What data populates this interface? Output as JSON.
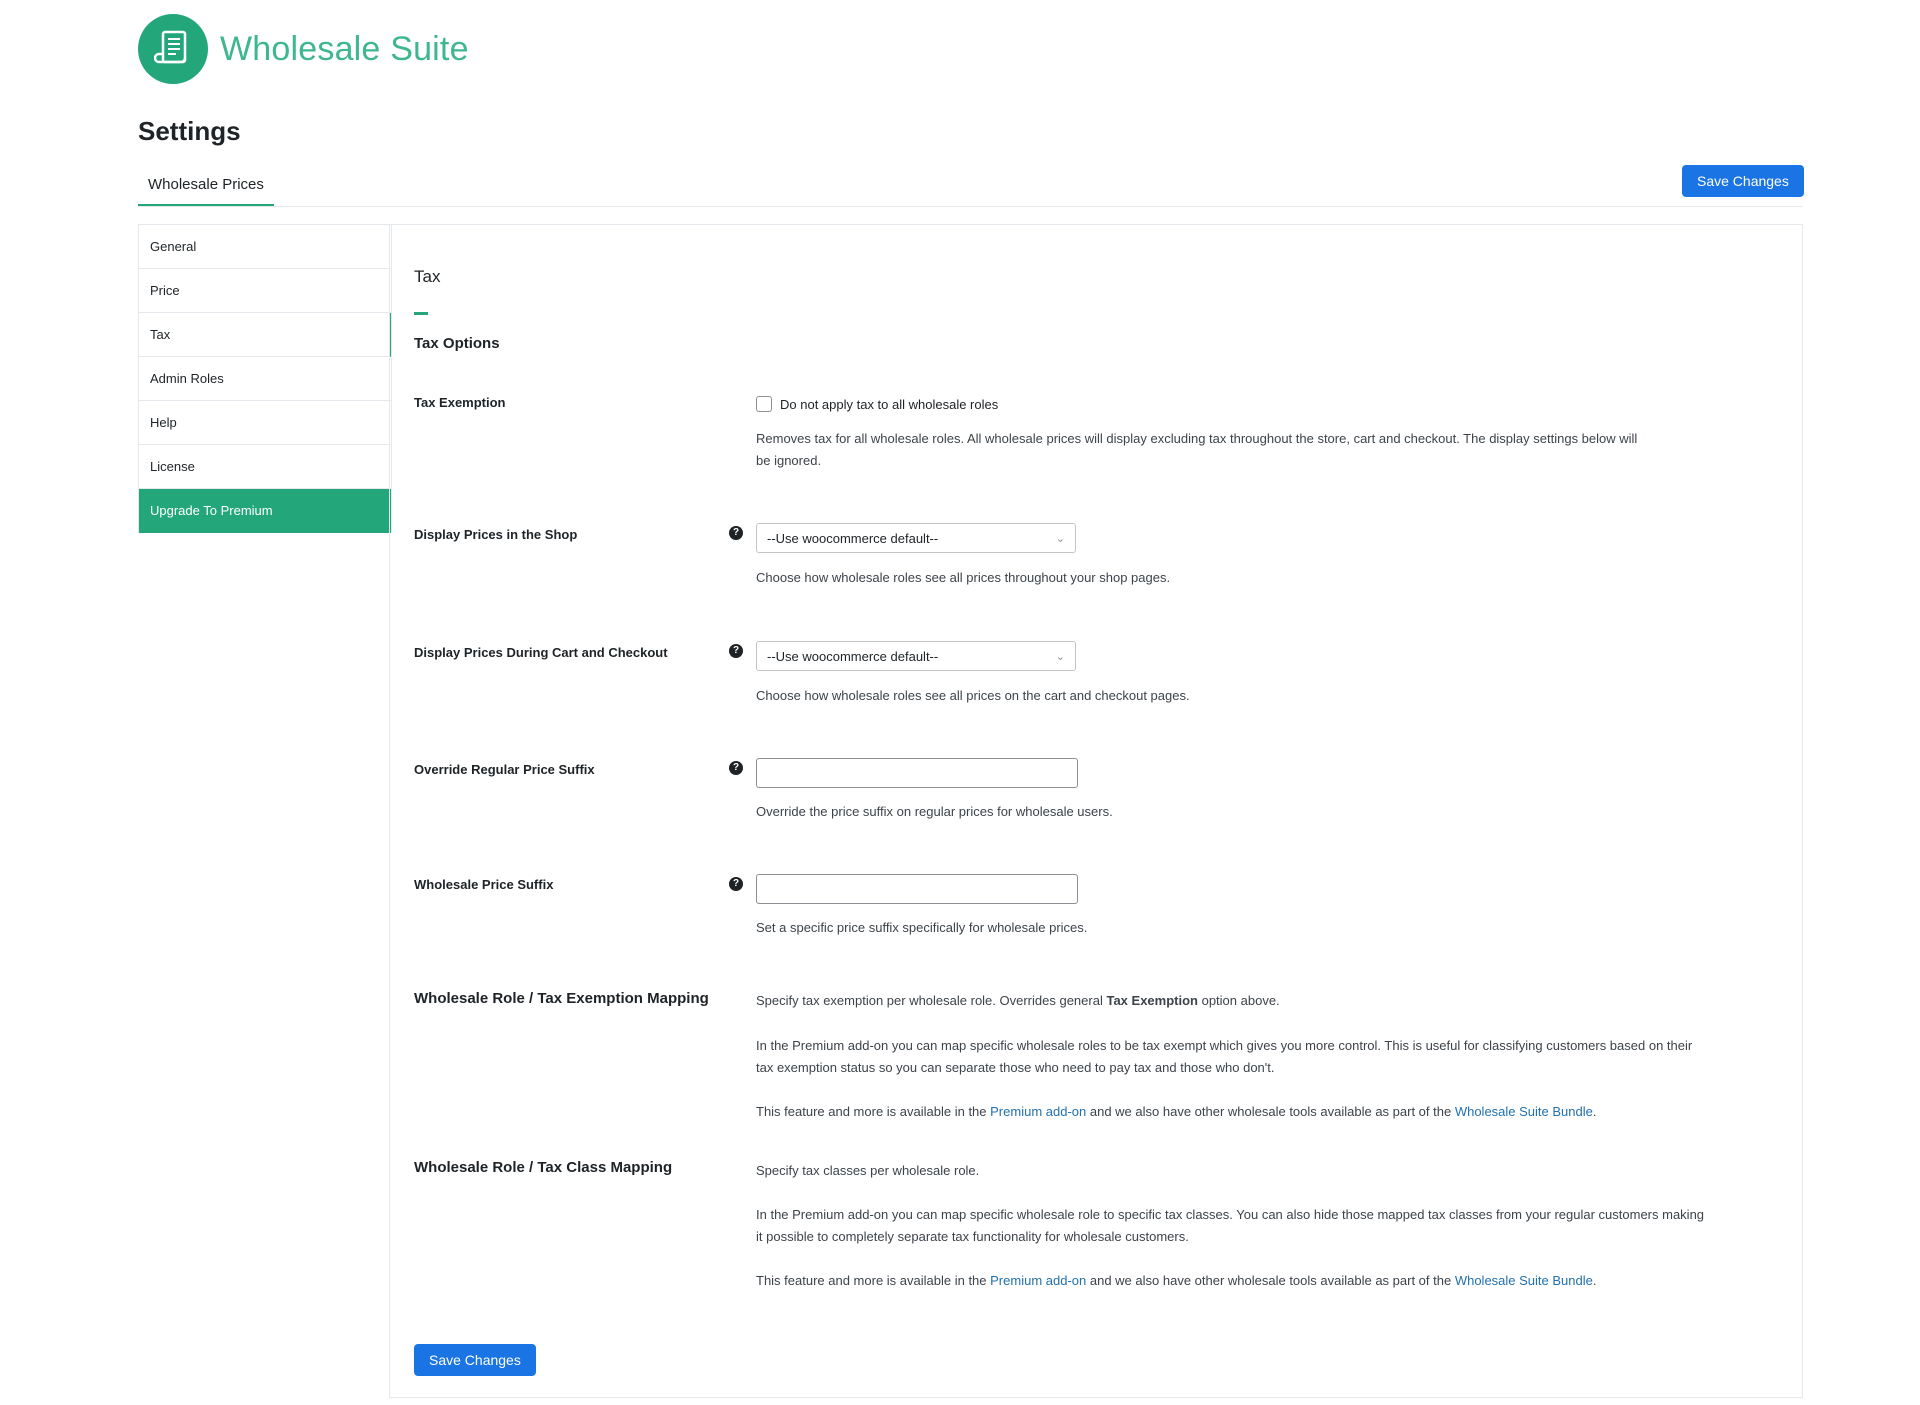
{
  "brand": {
    "name": "Wholesale Suite",
    "logo_icon": "document-scroll-icon",
    "color": "#23a77a"
  },
  "page": {
    "title": "Settings"
  },
  "tabs": [
    {
      "label": "Wholesale Prices",
      "active": true
    }
  ],
  "toolbar": {
    "save_label": "Save Changes"
  },
  "sidebar": {
    "items": [
      {
        "label": "General"
      },
      {
        "label": "Price"
      },
      {
        "label": "Tax",
        "active": true
      },
      {
        "label": "Admin Roles"
      },
      {
        "label": "Help"
      },
      {
        "label": "License"
      },
      {
        "label": "Upgrade To Premium",
        "highlight": true
      }
    ]
  },
  "tax": {
    "section_title": "Tax",
    "options_title": "Tax Options",
    "exemption": {
      "label": "Tax Exemption",
      "checkbox_label": "Do not apply tax to all wholesale roles",
      "checked": false,
      "desc_line1": "Removes tax for all wholesale roles. All wholesale prices will display excluding tax throughout the store, cart and checkout. The display settings below will",
      "desc_line2": "be ignored."
    },
    "display_shop": {
      "label": "Display Prices in the Shop",
      "value": "--Use woocommerce default--",
      "desc": "Choose how wholesale roles see all prices throughout your shop pages."
    },
    "display_cart": {
      "label": "Display Prices During Cart and Checkout",
      "value": "--Use woocommerce default--",
      "desc": "Choose how wholesale roles see all prices on the cart and checkout pages."
    },
    "override_suffix": {
      "label": "Override Regular Price Suffix",
      "value": "",
      "desc": "Override the price suffix on regular prices for wholesale users."
    },
    "wholesale_suffix": {
      "label": "Wholesale Price Suffix",
      "value": "",
      "desc": "Set a specific price suffix specifically for wholesale prices."
    },
    "exemption_mapping": {
      "label": "Wholesale Role / Tax Exemption Mapping",
      "intro_pre": "Specify tax exemption per wholesale role. Overrides general ",
      "intro_bold": "Tax Exemption",
      "intro_post": " option above.",
      "body_line1": "In the Premium add-on you can map specific wholesale roles to be tax exempt which gives you more control. This is useful for classifying customers based on their",
      "body_line2": "tax exemption status so you can separate those who need to pay tax and those who don't.",
      "feature_pre": "This feature and more is available in the ",
      "feature_link1": "Premium add-on",
      "feature_mid": " and we also have other wholesale tools available as part of the ",
      "feature_link2": "Wholesale Suite Bundle",
      "feature_post": "."
    },
    "class_mapping": {
      "label": "Wholesale Role / Tax Class Mapping",
      "intro": "Specify tax classes per wholesale role.",
      "body_line1": "In the Premium add-on you can map specific wholesale role to specific tax classes. You can also hide those mapped tax classes from your regular customers making",
      "body_line2": "it possible to completely separate tax functionality for wholesale customers.",
      "feature_pre": "This feature and more is available in the ",
      "feature_link1": "Premium add-on",
      "feature_mid": " and we also have other wholesale tools available as part of the ",
      "feature_link2": "Wholesale Suite Bundle",
      "feature_post": "."
    }
  },
  "help_icon": "question-circle-icon",
  "dropdown_icon": "chevron-down-icon",
  "colors": {
    "accent": "#23a77a",
    "primary_button": "#1b74e4",
    "link": "#2271b1"
  }
}
